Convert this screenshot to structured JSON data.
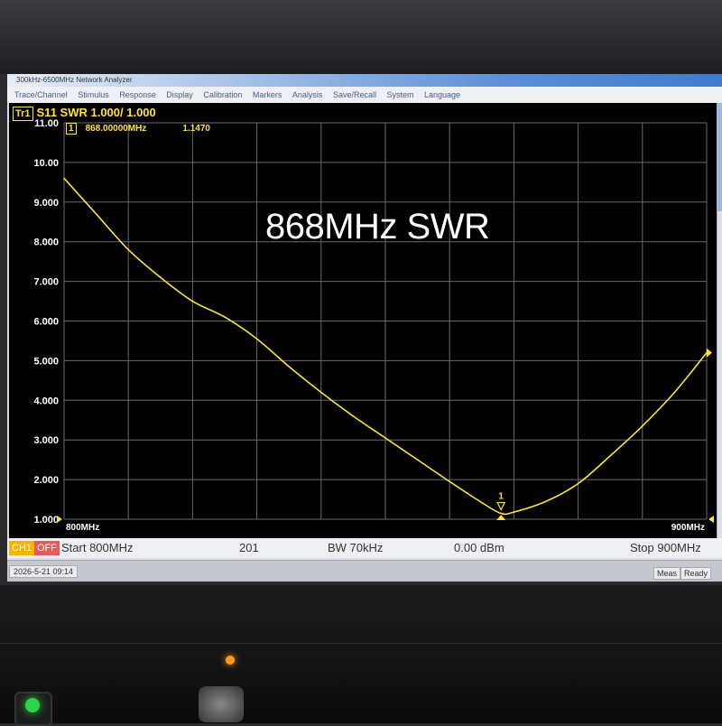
{
  "window": {
    "title": "300kHz-6500MHz Network Analyzer"
  },
  "menu": [
    "Trace/Channel",
    "Stimulus",
    "Response",
    "Display",
    "Calibration",
    "Markers",
    "Analysis",
    "Save/Recall",
    "System",
    "Language"
  ],
  "trace": {
    "badge": "Tr1",
    "label": "S11 SWR 1.000/ 1.000"
  },
  "marker": {
    "id": "1",
    "freq": "868.00000MHz",
    "value": "1.1470",
    "label": "1"
  },
  "overlay_text": "868MHz SWR",
  "status_bar": {
    "channel": "CH1",
    "power_state": "OFF",
    "start": "Start 800MHz",
    "points": "201",
    "bw": "BW 70kHz",
    "power": "0.00 dBm",
    "stop": "Stop 900MHz"
  },
  "bottom_bar": {
    "datetime": "2026-5-21 09:14",
    "meas": "Meas",
    "ready": "Ready"
  },
  "colors": {
    "trace": "#ffe23a",
    "grid": "#6a6a6a",
    "background": "#000000"
  },
  "chart_data": {
    "type": "line",
    "title": "",
    "xlabel": "",
    "ylabel": "",
    "x_tick_labels": [
      "800MHz",
      "900MHz"
    ],
    "y_tick_labels": [
      "11.00",
      "10.00",
      "9.000",
      "8.000",
      "7.000",
      "6.000",
      "5.000",
      "4.000",
      "3.000",
      "2.000",
      "1.000"
    ],
    "xlim": [
      800,
      900
    ],
    "ylim": [
      1,
      11
    ],
    "grid": true,
    "x": [
      800,
      805,
      810,
      815,
      820,
      825,
      830,
      835,
      840,
      845,
      850,
      855,
      860,
      865,
      868,
      870,
      875,
      880,
      885,
      890,
      895,
      900
    ],
    "y": [
      9.6,
      8.7,
      7.8,
      7.1,
      6.5,
      6.1,
      5.55,
      4.85,
      4.2,
      3.6,
      3.05,
      2.5,
      1.95,
      1.42,
      1.147,
      1.18,
      1.45,
      1.9,
      2.6,
      3.35,
      4.2,
      5.2
    ],
    "marker": {
      "x": 868,
      "y": 1.147
    }
  }
}
